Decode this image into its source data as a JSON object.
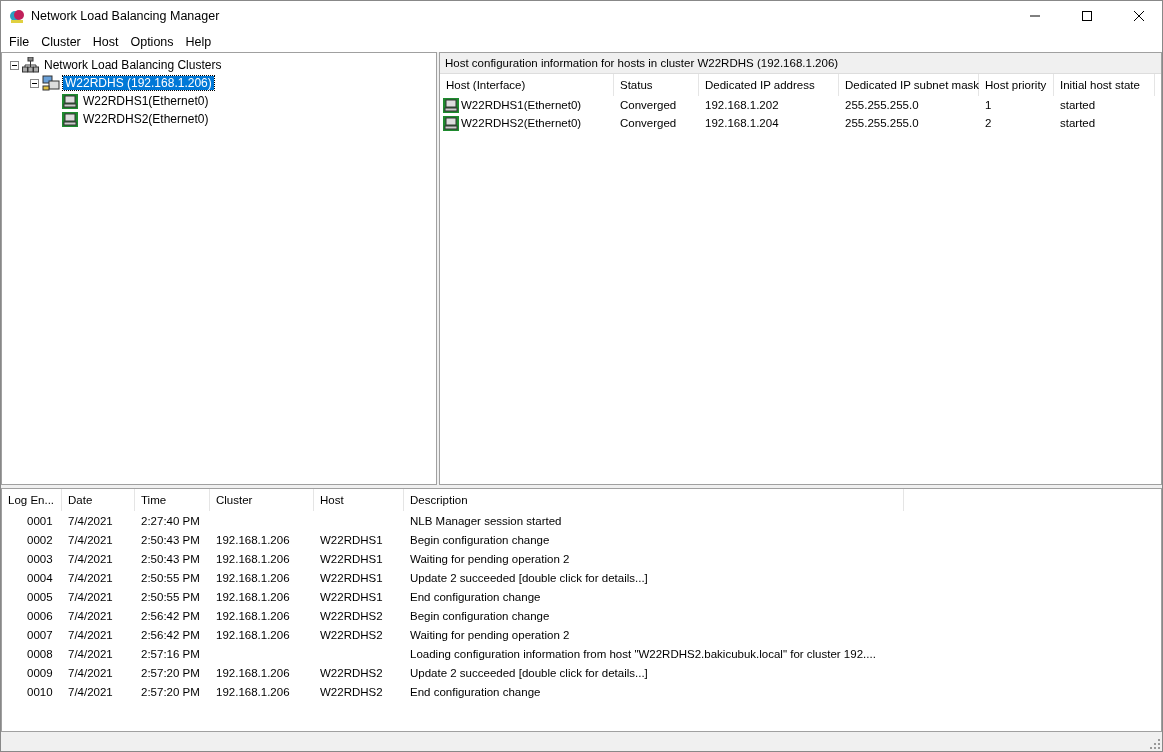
{
  "window": {
    "title": "Network Load Balancing Manager"
  },
  "menu": [
    "File",
    "Cluster",
    "Host",
    "Options",
    "Help"
  ],
  "tree": [
    {
      "label": "Network Load Balancing Clusters",
      "kind": "root",
      "expanded": true,
      "selected": false,
      "children": [
        {
          "label": "W22RDHS (192.168.1.206)",
          "kind": "cluster",
          "expanded": true,
          "selected": true,
          "children": [
            {
              "label": "W22RDHS1(Ethernet0)",
              "kind": "host",
              "selected": false
            },
            {
              "label": "W22RDHS2(Ethernet0)",
              "kind": "host",
              "selected": false
            }
          ]
        }
      ]
    }
  ],
  "hosts_panel": {
    "title": "Host configuration information for hosts in cluster W22RDHS (192.168.1.206)",
    "columns": [
      "Host (Interface)",
      "Status",
      "Dedicated IP address",
      "Dedicated IP subnet mask",
      "Host priority",
      "Initial host state"
    ],
    "rows": [
      [
        "W22RDHS1(Ethernet0)",
        "Converged",
        "192.168.1.202",
        "255.255.255.0",
        "1",
        "started"
      ],
      [
        "W22RDHS2(Ethernet0)",
        "Converged",
        "192.168.1.204",
        "255.255.255.0",
        "2",
        "started"
      ]
    ]
  },
  "log": {
    "columns": [
      "Log En...",
      "Date",
      "Time",
      "Cluster",
      "Host",
      "Description"
    ],
    "rows": [
      [
        "0001",
        "7/4/2021",
        "2:27:40 PM",
        "",
        "",
        "NLB Manager session started"
      ],
      [
        "0002",
        "7/4/2021",
        "2:50:43 PM",
        "192.168.1.206",
        "W22RDHS1",
        "Begin configuration change"
      ],
      [
        "0003",
        "7/4/2021",
        "2:50:43 PM",
        "192.168.1.206",
        "W22RDHS1",
        "Waiting for pending operation 2"
      ],
      [
        "0004",
        "7/4/2021",
        "2:50:55 PM",
        "192.168.1.206",
        "W22RDHS1",
        "Update 2 succeeded [double click for details...]"
      ],
      [
        "0005",
        "7/4/2021",
        "2:50:55 PM",
        "192.168.1.206",
        "W22RDHS1",
        "End configuration change"
      ],
      [
        "0006",
        "7/4/2021",
        "2:56:42 PM",
        "192.168.1.206",
        "W22RDHS2",
        "Begin configuration change"
      ],
      [
        "0007",
        "7/4/2021",
        "2:56:42 PM",
        "192.168.1.206",
        "W22RDHS2",
        "Waiting for pending operation 2"
      ],
      [
        "0008",
        "7/4/2021",
        "2:57:16 PM",
        "",
        "",
        "Loading configuration information from host \"W22RDHS2.bakicubuk.local\" for cluster 192...."
      ],
      [
        "0009",
        "7/4/2021",
        "2:57:20 PM",
        "192.168.1.206",
        "W22RDHS2",
        "Update 2 succeeded [double click for details...]"
      ],
      [
        "0010",
        "7/4/2021",
        "2:57:20 PM",
        "192.168.1.206",
        "W22RDHS2",
        "End configuration change"
      ]
    ]
  }
}
